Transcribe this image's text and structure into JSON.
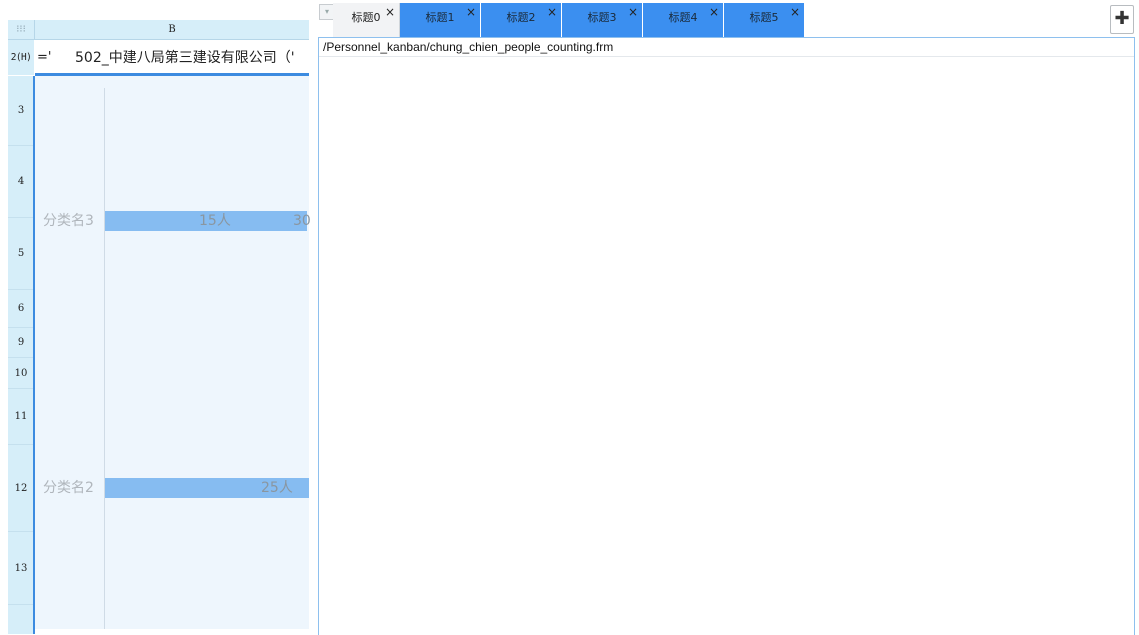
{
  "sheet": {
    "corner_icon": "grid-icon",
    "column_header": "B",
    "formula_row": {
      "row_label": "2(H)",
      "prefix": "='",
      "text": "502_中建八局第三建设有限公司（'"
    },
    "row_headers": [
      "3",
      "4",
      "5",
      "6",
      "9",
      "10",
      "11",
      "12",
      "13"
    ]
  },
  "chart_data": {
    "type": "bar",
    "orientation": "horizontal",
    "categories": [
      "分类名3",
      "分类名2"
    ],
    "series": [
      {
        "values": [
          15,
          25
        ],
        "data_labels": [
          "15人",
          "25人"
        ]
      }
    ],
    "overflow_labels": [
      "30"
    ],
    "bar_color": "#86bcf1",
    "title": "",
    "xlabel": "",
    "ylabel": ""
  },
  "tabs": {
    "items": [
      {
        "label": "标题0",
        "active": true
      },
      {
        "label": "标题1",
        "active": false
      },
      {
        "label": "标题2",
        "active": false
      },
      {
        "label": "标题3",
        "active": false
      },
      {
        "label": "标题4",
        "active": false
      },
      {
        "label": "标题5",
        "active": false
      }
    ],
    "close_glyph": "×",
    "add_icon": "add-tab-icon",
    "menu_icon": "dropdown-icon",
    "active_color": "#f2f3f5",
    "tab_color": "#3b8ff0"
  },
  "content": {
    "path": "/Personnel_kanban/chung_chien_people_counting.frm"
  }
}
